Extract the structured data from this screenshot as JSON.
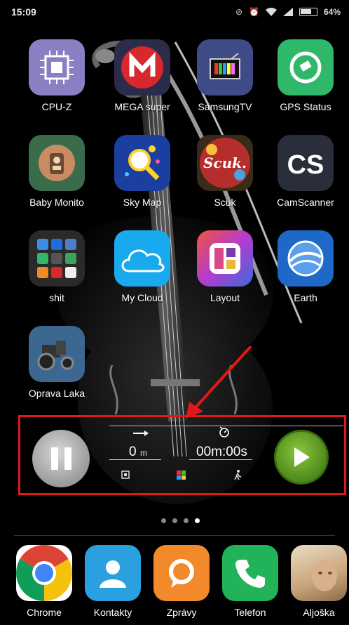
{
  "status_bar": {
    "time": "15:09",
    "battery": "64%"
  },
  "apps": [
    {
      "label": "CPU-Z",
      "icon": "cpu-icon",
      "color": "#8b7fc4"
    },
    {
      "label": "MEGA super",
      "icon": "mega-icon",
      "color": "#d9272e"
    },
    {
      "label": "SamsungTV",
      "icon": "tv-icon",
      "color": "#3f4b86"
    },
    {
      "label": "GPS Status",
      "icon": "satellite-icon",
      "color": "#2fb86a"
    },
    {
      "label": "Baby Monito",
      "icon": "baby-monitor-icon",
      "color": "#3a6b4a"
    },
    {
      "label": "Sky Map",
      "icon": "sky-map-icon",
      "color": "#1b3fa0"
    },
    {
      "label": "Scuk",
      "icon": "scuk-icon",
      "color": "#b62d2d"
    },
    {
      "label": "CamScanner",
      "icon": "camscanner-icon",
      "color": "#2a2e3a"
    },
    {
      "label": "shit",
      "icon": "folder-icon",
      "color": "#2a2a2a"
    },
    {
      "label": "My Cloud",
      "icon": "cloud-icon",
      "color": "#19a9ee"
    },
    {
      "label": "Layout",
      "icon": "layout-icon",
      "color": "#7a3ab0"
    },
    {
      "label": "Earth",
      "icon": "earth-icon",
      "color": "#1e68c8"
    },
    {
      "label": "Oprava Laka",
      "icon": "tractor-icon",
      "color": "#3b6790"
    }
  ],
  "widget": {
    "distance_value": "0",
    "distance_unit": "m",
    "time": "00m:00s"
  },
  "dock": [
    {
      "label": "Chrome",
      "icon": "chrome-icon"
    },
    {
      "label": "Kontakty",
      "icon": "contacts-icon"
    },
    {
      "label": "Zprávy",
      "icon": "messages-icon"
    },
    {
      "label": "Telefon",
      "icon": "phone-icon"
    },
    {
      "label": "Aljoška",
      "icon": "avatar-photo"
    }
  ],
  "pages": {
    "count": 4,
    "active_index": 3
  }
}
